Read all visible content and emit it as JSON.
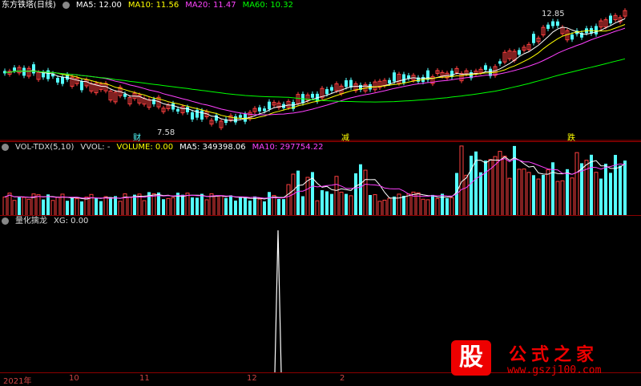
{
  "main": {
    "stock_name": "东方铁塔(日线)",
    "ma5": "MA5: 12.00",
    "ma10": "MA10: 11.56",
    "ma20": "MA20: 11.47",
    "ma60": "MA60: 10.32",
    "high_label": "12.85",
    "low_label": "7.58",
    "marker_cai": "财",
    "marker_jian": "减",
    "marker_die": "跌"
  },
  "volume": {
    "title": "VOL-TDX(5,10)",
    "vvol": "VVOL: -",
    "volume": "VOLUME: 0.00",
    "ma5": "MA5: 349398.06",
    "ma10": "MA10: 297754.22"
  },
  "indicator": {
    "title": "量化擒龙",
    "xg": "XG: 0.00"
  },
  "xaxis": {
    "labels": [
      "2021年",
      "10",
      "11",
      "12",
      "2"
    ]
  },
  "watermark": {
    "gu": "股",
    "name": "公式之家",
    "url": "www.gszj100.com"
  },
  "colors": {
    "up": "#ff4040",
    "down": "#54ffff",
    "ma5": "#ffffff",
    "ma10": "#ffff00",
    "ma20": "#ff40ff",
    "ma60": "#00ff00",
    "grid": "#8b0000"
  }
}
